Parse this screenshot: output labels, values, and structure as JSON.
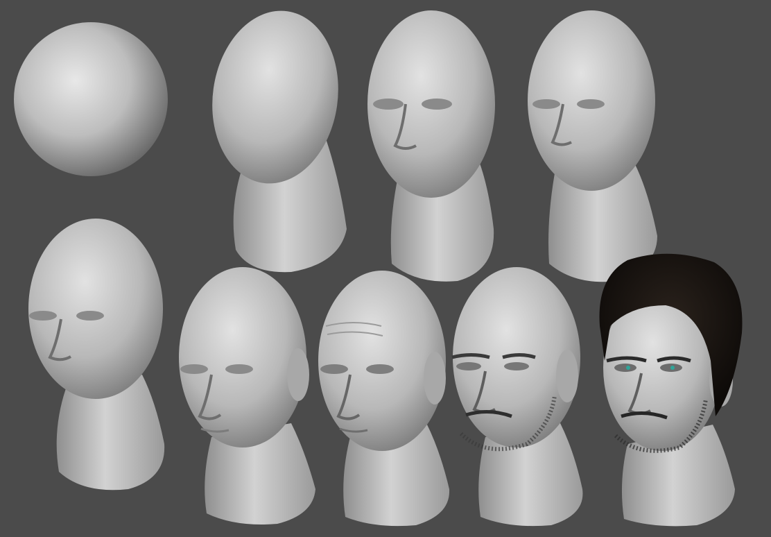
{
  "scene": {
    "background_color": "#4b4b4b",
    "clay_color": "#c9c9c9",
    "hair_color": "#1a1410",
    "eye_color": "#2fa59a",
    "stages": [
      {
        "index": 1,
        "form": "sphere"
      },
      {
        "index": 2,
        "form": "egg-head-with-neck"
      },
      {
        "index": 3,
        "form": "blocked-out-face"
      },
      {
        "index": 4,
        "form": "refined-face"
      },
      {
        "index": 5,
        "form": "rounded-skull-face"
      },
      {
        "index": 6,
        "form": "head-with-ears"
      },
      {
        "index": 7,
        "form": "detailed-face-wrinkles"
      },
      {
        "index": 8,
        "form": "face-with-stubble"
      },
      {
        "index": 9,
        "form": "face-with-hair-and-eyes"
      }
    ]
  }
}
